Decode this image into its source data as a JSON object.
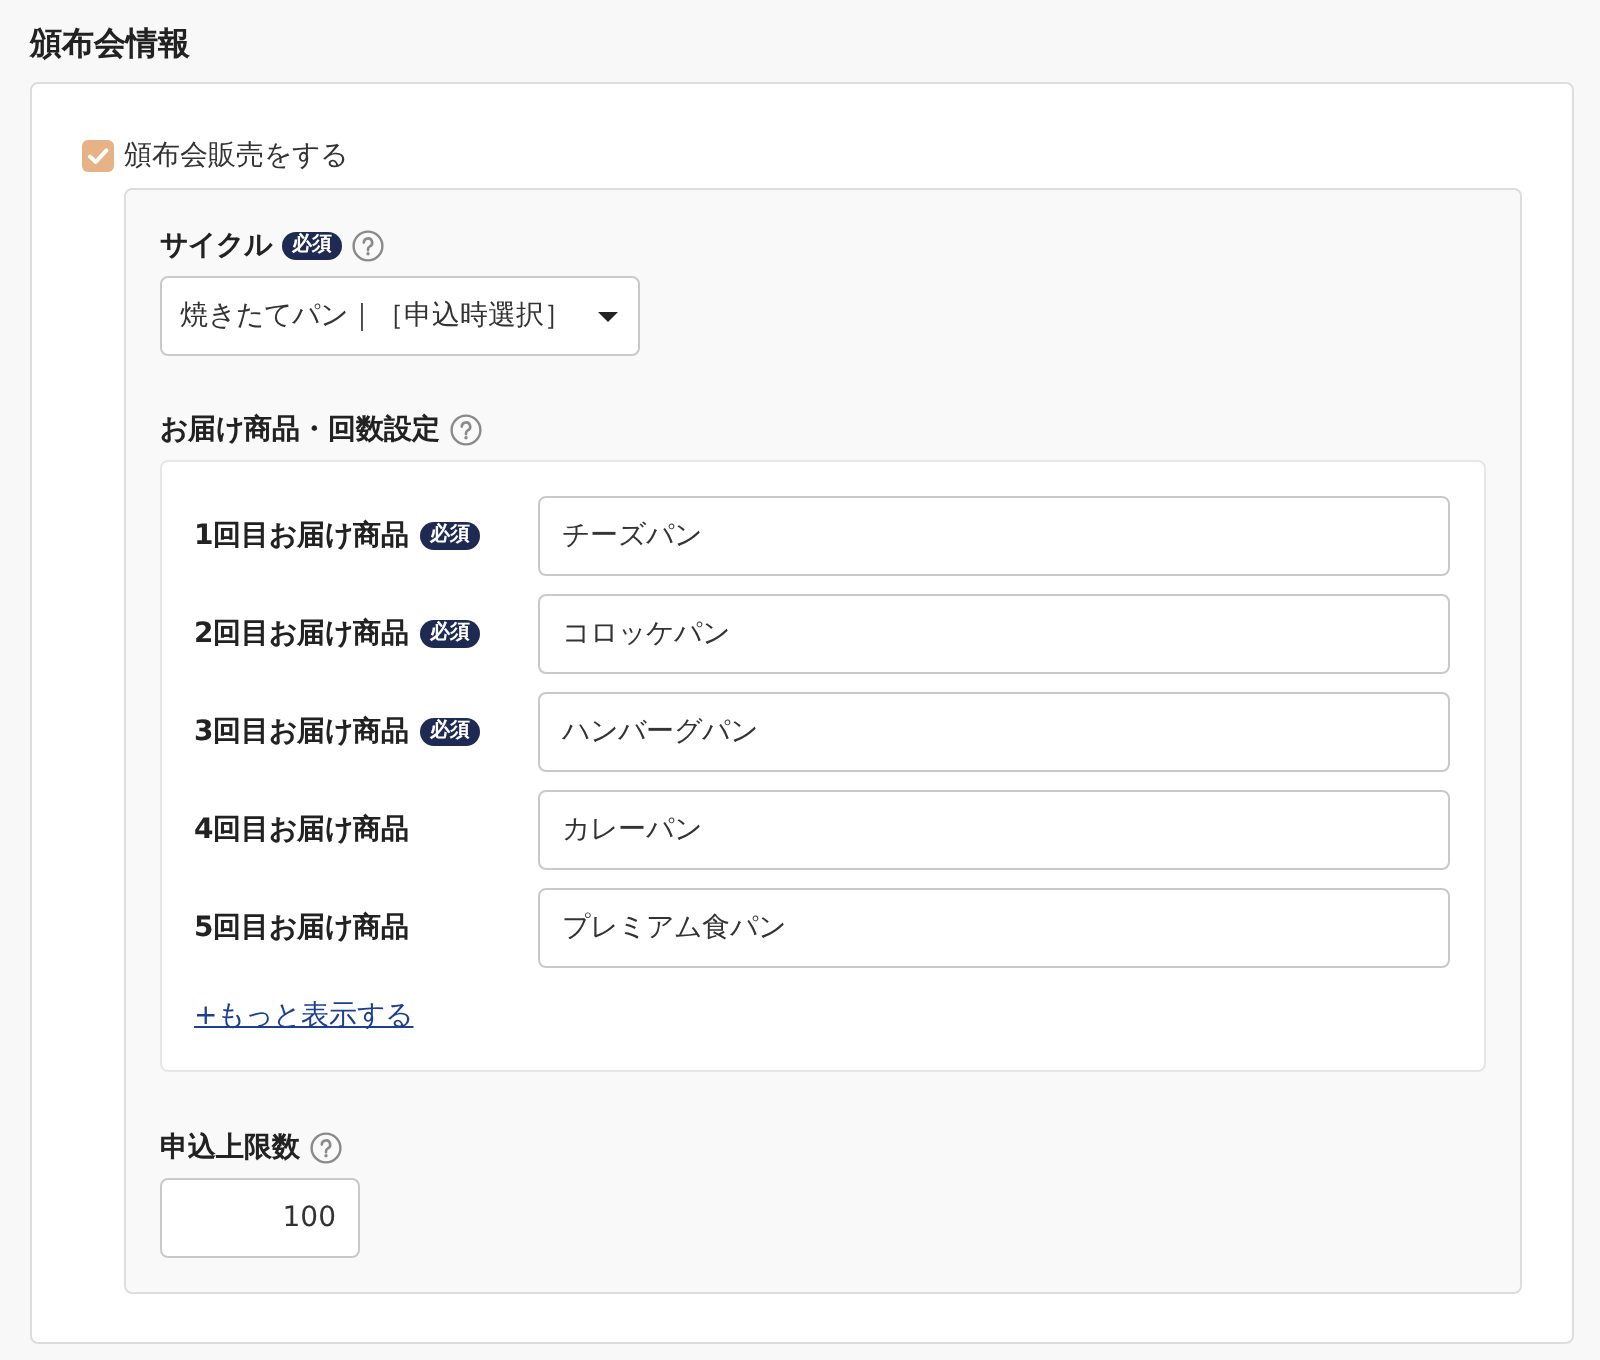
{
  "section": {
    "title": "頒布会情報"
  },
  "subscription_toggle": {
    "label": "頒布会販売をする",
    "checked": true
  },
  "cycle": {
    "label": "サイクル",
    "badge": "必須",
    "help": true,
    "value": "焼きたてパン｜［申込時選択］"
  },
  "delivery": {
    "label": "お届け商品・回数設定",
    "help": true,
    "items": [
      {
        "label": "1回目お届け商品",
        "badge": "必須",
        "value": "チーズパン"
      },
      {
        "label": "2回目お届け商品",
        "badge": "必須",
        "value": "コロッケパン"
      },
      {
        "label": "3回目お届け商品",
        "badge": "必須",
        "value": "ハンバーグパン"
      },
      {
        "label": "4回目お届け商品",
        "value": "カレーパン"
      },
      {
        "label": "5回目お届け商品",
        "value": "プレミアム食パン"
      }
    ],
    "more_link": "+もっと表示する"
  },
  "limit": {
    "label": "申込上限数",
    "help": true,
    "value": "100"
  }
}
